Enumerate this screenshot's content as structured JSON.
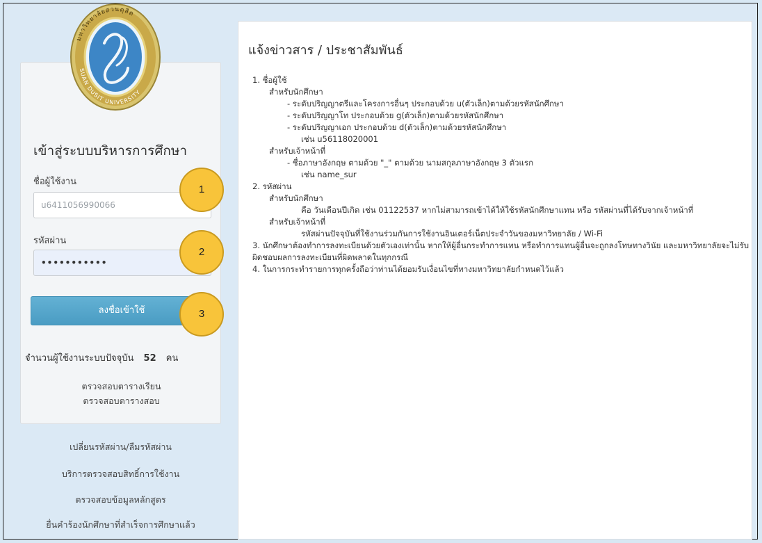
{
  "login": {
    "title": "เข้าสู่ระบบบริหารการศึกษา",
    "username_label": "ชื่อผู้ใช้งาน",
    "username_value": "u6411056990066",
    "password_label": "รหัสผ่าน",
    "password_value": "•••••••••••",
    "login_button": "ลงชื่อเข้าใช้",
    "online_prefix": "จำนวนผู้ใช้งานระบบปัจจุบัน",
    "online_count": "52",
    "online_suffix": "คน",
    "link_timetable": "ตรวจสอบตารางเรียน",
    "link_exam": "ตรวจสอบตารางสอบ"
  },
  "bottom_links": [
    "เปลี่ยนรหัสผ่าน/ลืมรหัสผ่าน",
    "บริการตรวจสอบสิทธิ์การใช้งาน",
    "ตรวจสอบข้อมูลหลักสูตร",
    "ยื่นคำร้องนักศึกษาที่สำเร็จการศึกษาแล้ว"
  ],
  "callouts": [
    "1",
    "2",
    "3"
  ],
  "logo": {
    "text_top": "มหาวิทยาลัยสวนดุสิต",
    "text_bottom": "SUAN DUSIT UNIVERSITY",
    "colors": {
      "ring": "#c7b15a",
      "inner": "#3d86c6",
      "accent": "#e7d27b"
    }
  },
  "news": {
    "title": "แจ้งข่าวสาร / ประชาสัมพันธ์",
    "lines": [
      "1. ชื่อผู้ใช้",
      "สำหรับนักศึกษา",
      "- ระดับปริญญาตรีและโครงการอื่นๆ ประกอบด้วย u(ตัวเล็ก)ตามด้วยรหัสนักศึกษา",
      "- ระดับปริญญาโท ประกอบด้วย g(ตัวเล็ก)ตามด้วยรหัสนักศึกษา",
      "- ระดับปริญญาเอก ประกอบด้วย d(ตัวเล็ก)ตามด้วยรหัสนักศึกษา",
      "เช่น u56118020001",
      "สำหรับเจ้าหน้าที่",
      "- ชื่อภาษาอังกฤษ ตามด้วย \"_\" ตามด้วย นามสกุลภาษาอังกฤษ 3 ตัวแรก",
      "เช่น name_sur",
      "2. รหัสผ่าน",
      "สำหรับนักศึกษา",
      "คือ วันเดือนปีเกิด เช่น 01122537 หากไม่สามารถเข้าได้ให้ใช้รหัสนักศึกษาแทน หรือ รหัสผ่านที่ได้รับจากเจ้าหน้าที่",
      "สำหรับเจ้าหน้าที่",
      "รหัสผ่านปัจจุบันที่ใช้งานร่วมกันการใช้งานอินเตอร์เน็ตประจำวันของมหาวิทยาลัย / Wi-Fi",
      "3. นักศึกษาต้องทำการลงทะเบียนด้วยตัวเองเท่านั้น หากให้ผู้อื่นกระทำการแทน หรือทำการแทนผู้อื่นจะถูกลงโทษทางวินัย และมหาวิทยาลัยจะไม่รับผิดชอบผลการลงทะเบียนที่ผิดพลาดในทุกกรณี",
      "4. ในการกระทำรายการทุกครั้งถือว่าท่านได้ยอมรับเงื่อนไขที่ทางมหาวิทยาลัยกำหนดไว้แล้ว"
    ]
  }
}
